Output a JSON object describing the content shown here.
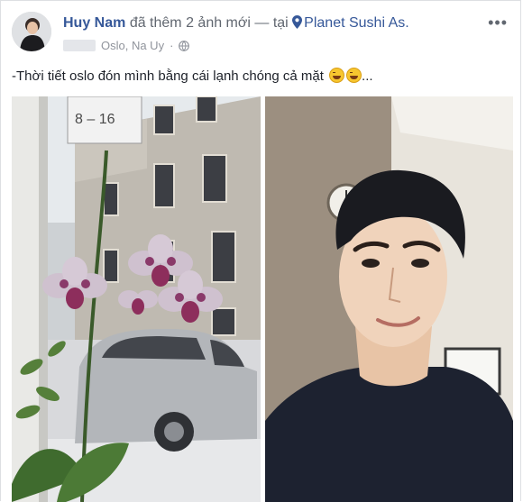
{
  "post": {
    "author": "Huy Nam",
    "action": "đã thêm 2 ảnh mới — tại",
    "place": "Planet Sushi As.",
    "location": "Oslo, Na Uy",
    "separator": "·",
    "status_text": "-Thời tiết oslo đón mình bằng cái lạnh chóng cả mặt",
    "status_suffix": "...",
    "emojis": [
      "grinning-sweat-emoji",
      "grinning-sweat-emoji"
    ],
    "sign_text": "8 – 16",
    "menu_icon": "more-options-icon"
  },
  "colors": {
    "link": "#365899",
    "text": "#1d2129",
    "muted": "#90949c"
  }
}
